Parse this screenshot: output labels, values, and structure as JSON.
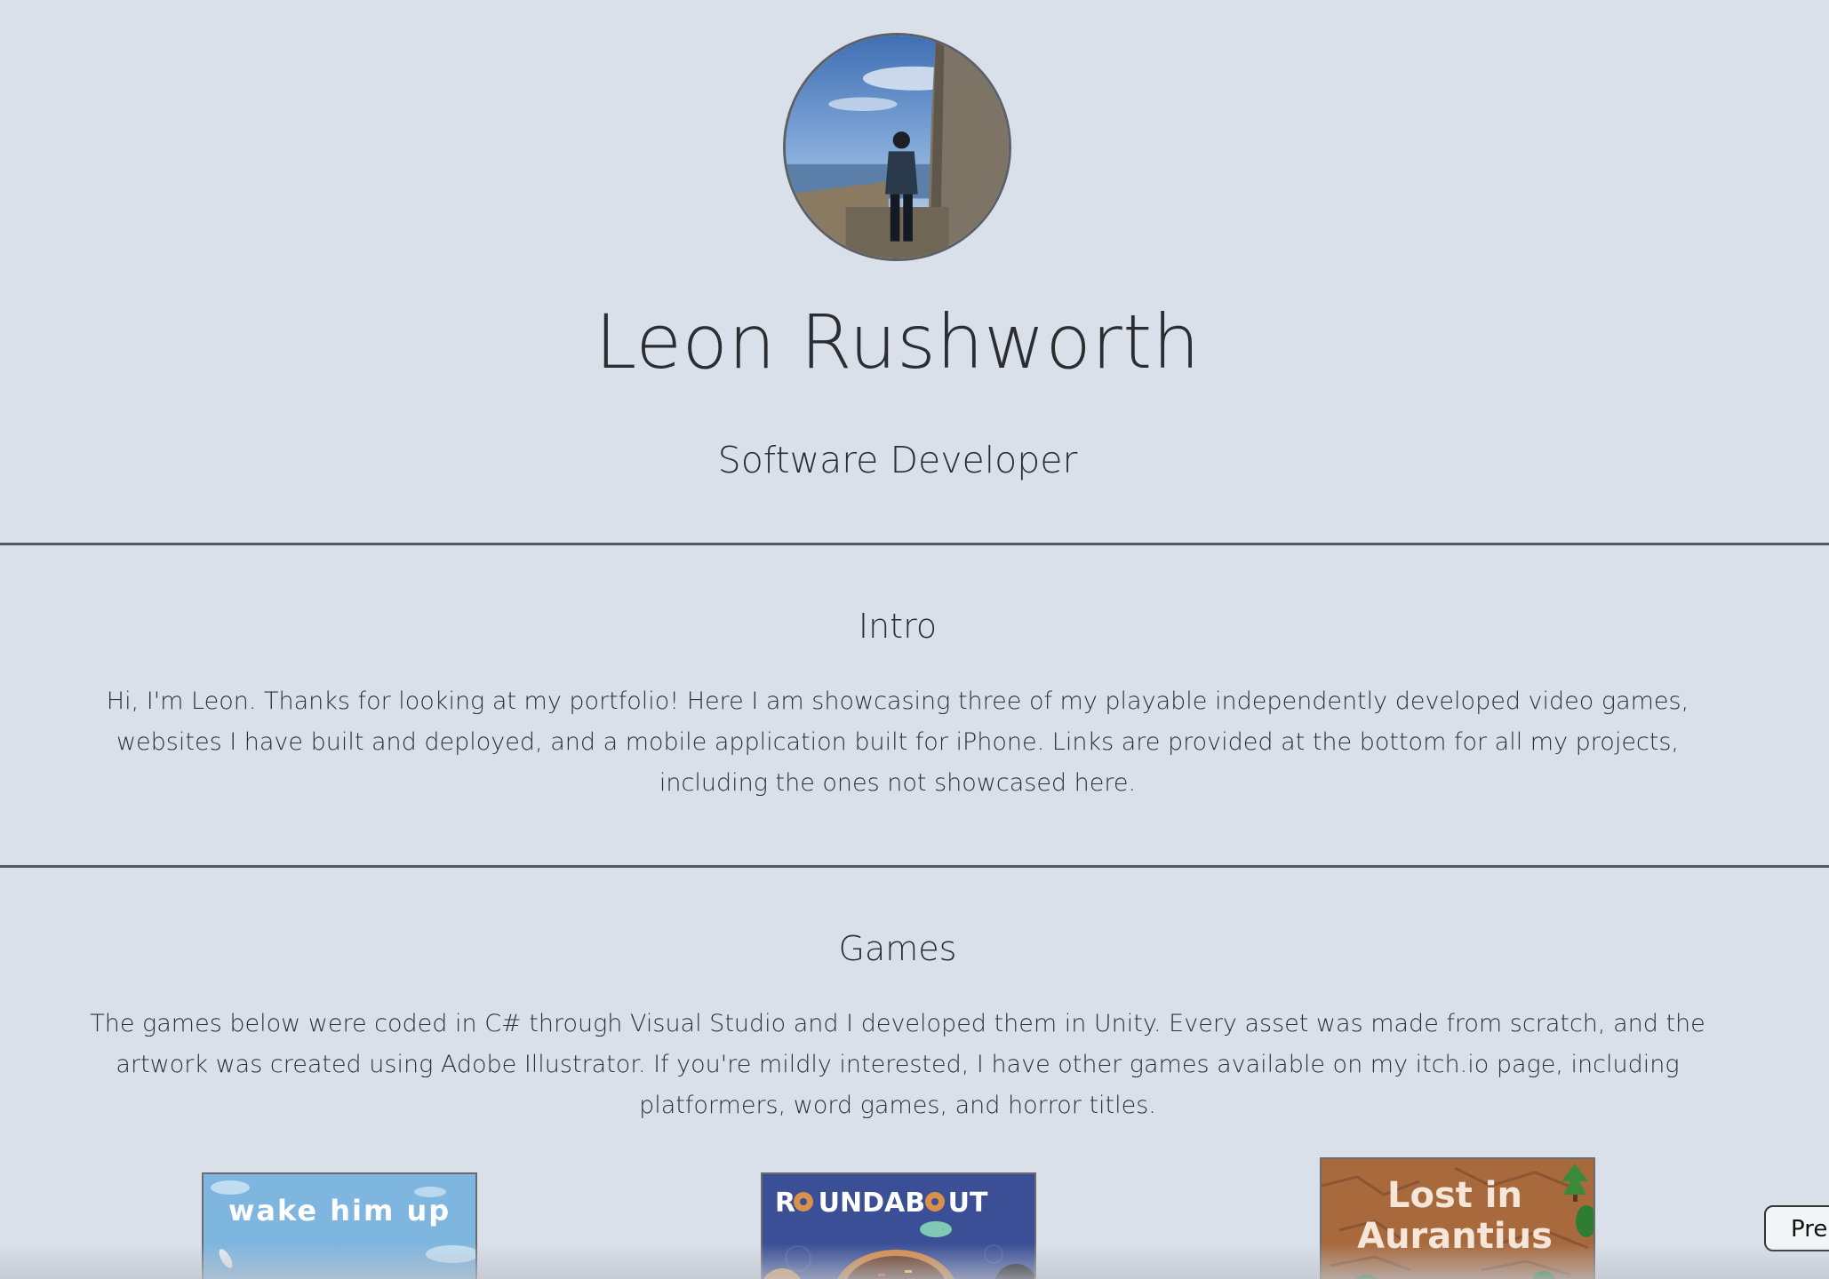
{
  "header": {
    "name": "Leon Rushworth",
    "role": "Software Developer"
  },
  "intro": {
    "title": "Intro",
    "text": "Hi, I'm Leon. Thanks for looking at my portfolio! Here I am showcasing three of my playable independently developed video games, websites I have built and deployed, and a mobile application built for iPhone. Links are provided at the bottom for all my projects, including the ones not showcased here."
  },
  "games": {
    "title": "Games",
    "text": "The games below were coded in C# through Visual Studio and I developed them in Unity. Every asset was made from scratch, and the artwork was created using Adobe Illustrator. If you're mildly interested, I have other games available on my itch.io page, including platformers, word games, and horror titles.",
    "items": [
      {
        "title": "wake him up"
      },
      {
        "title_part1": "R",
        "title_part2": "UNDAB",
        "title_part3": "UT"
      },
      {
        "title_line1": "Lost in",
        "title_line2": "Aurantius"
      }
    ]
  },
  "press_button": {
    "label": "Pre"
  },
  "colors": {
    "background": "#dae0ea",
    "text": "#2b2d31",
    "rule": "#55585e"
  },
  "icons": [
    "profile-photo"
  ]
}
